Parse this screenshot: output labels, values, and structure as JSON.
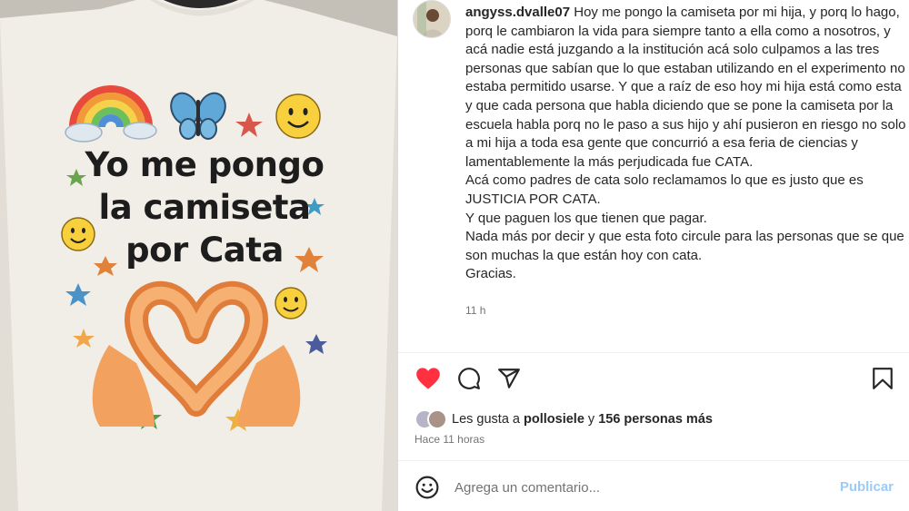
{
  "post": {
    "image": {
      "shirt_lines": [
        "Yo me pongo",
        "la camiseta",
        "por Cata"
      ]
    },
    "author": {
      "username": "angyss.dvalle07"
    },
    "caption": " Hoy me pongo la camiseta por mi hija, y porq lo hago, porq le cambiaron la vida para siempre tanto a ella como a nosotros, y acá nadie está juzgando a la institución acá solo culpamos a las tres personas que sabían que lo que estaban utilizando en el experimento no estaba permitido usarse. Y que a raíz de eso hoy mi hija está como esta y que cada persona que habla diciendo que se pone la camiseta por la escuela habla porq no le paso a sus hijo y ahí pusieron en riesgo no solo a mi hija a toda esa gente que concurrió a esa feria de ciencias y lamentablemente la más perjudicada fue CATA.\nAcá como padres de cata solo reclamamos lo que es justo que es JUSTICIA POR CATA.\nY que paguen los que tienen que pagar.\nNada más por decir y que esta foto circule para las personas que se que son muchas la que están hoy con cata.\nGracias.",
    "caption_time": "11 h",
    "likes": {
      "prefix": "Les gusta a ",
      "user": "pollosiele",
      "middle": " y ",
      "others": "156 personas más"
    },
    "posted_ago": "Hace 11 horas",
    "comment": {
      "placeholder": "Agrega un comentario...",
      "publish_label": "Publicar"
    },
    "colors": {
      "like_red": "#ff3040",
      "publish_blue": "#9ccbf7",
      "secondary_text": "#737373"
    },
    "icons": [
      "heart-icon",
      "comment-icon",
      "share-icon",
      "save-icon",
      "emoji-icon"
    ]
  }
}
